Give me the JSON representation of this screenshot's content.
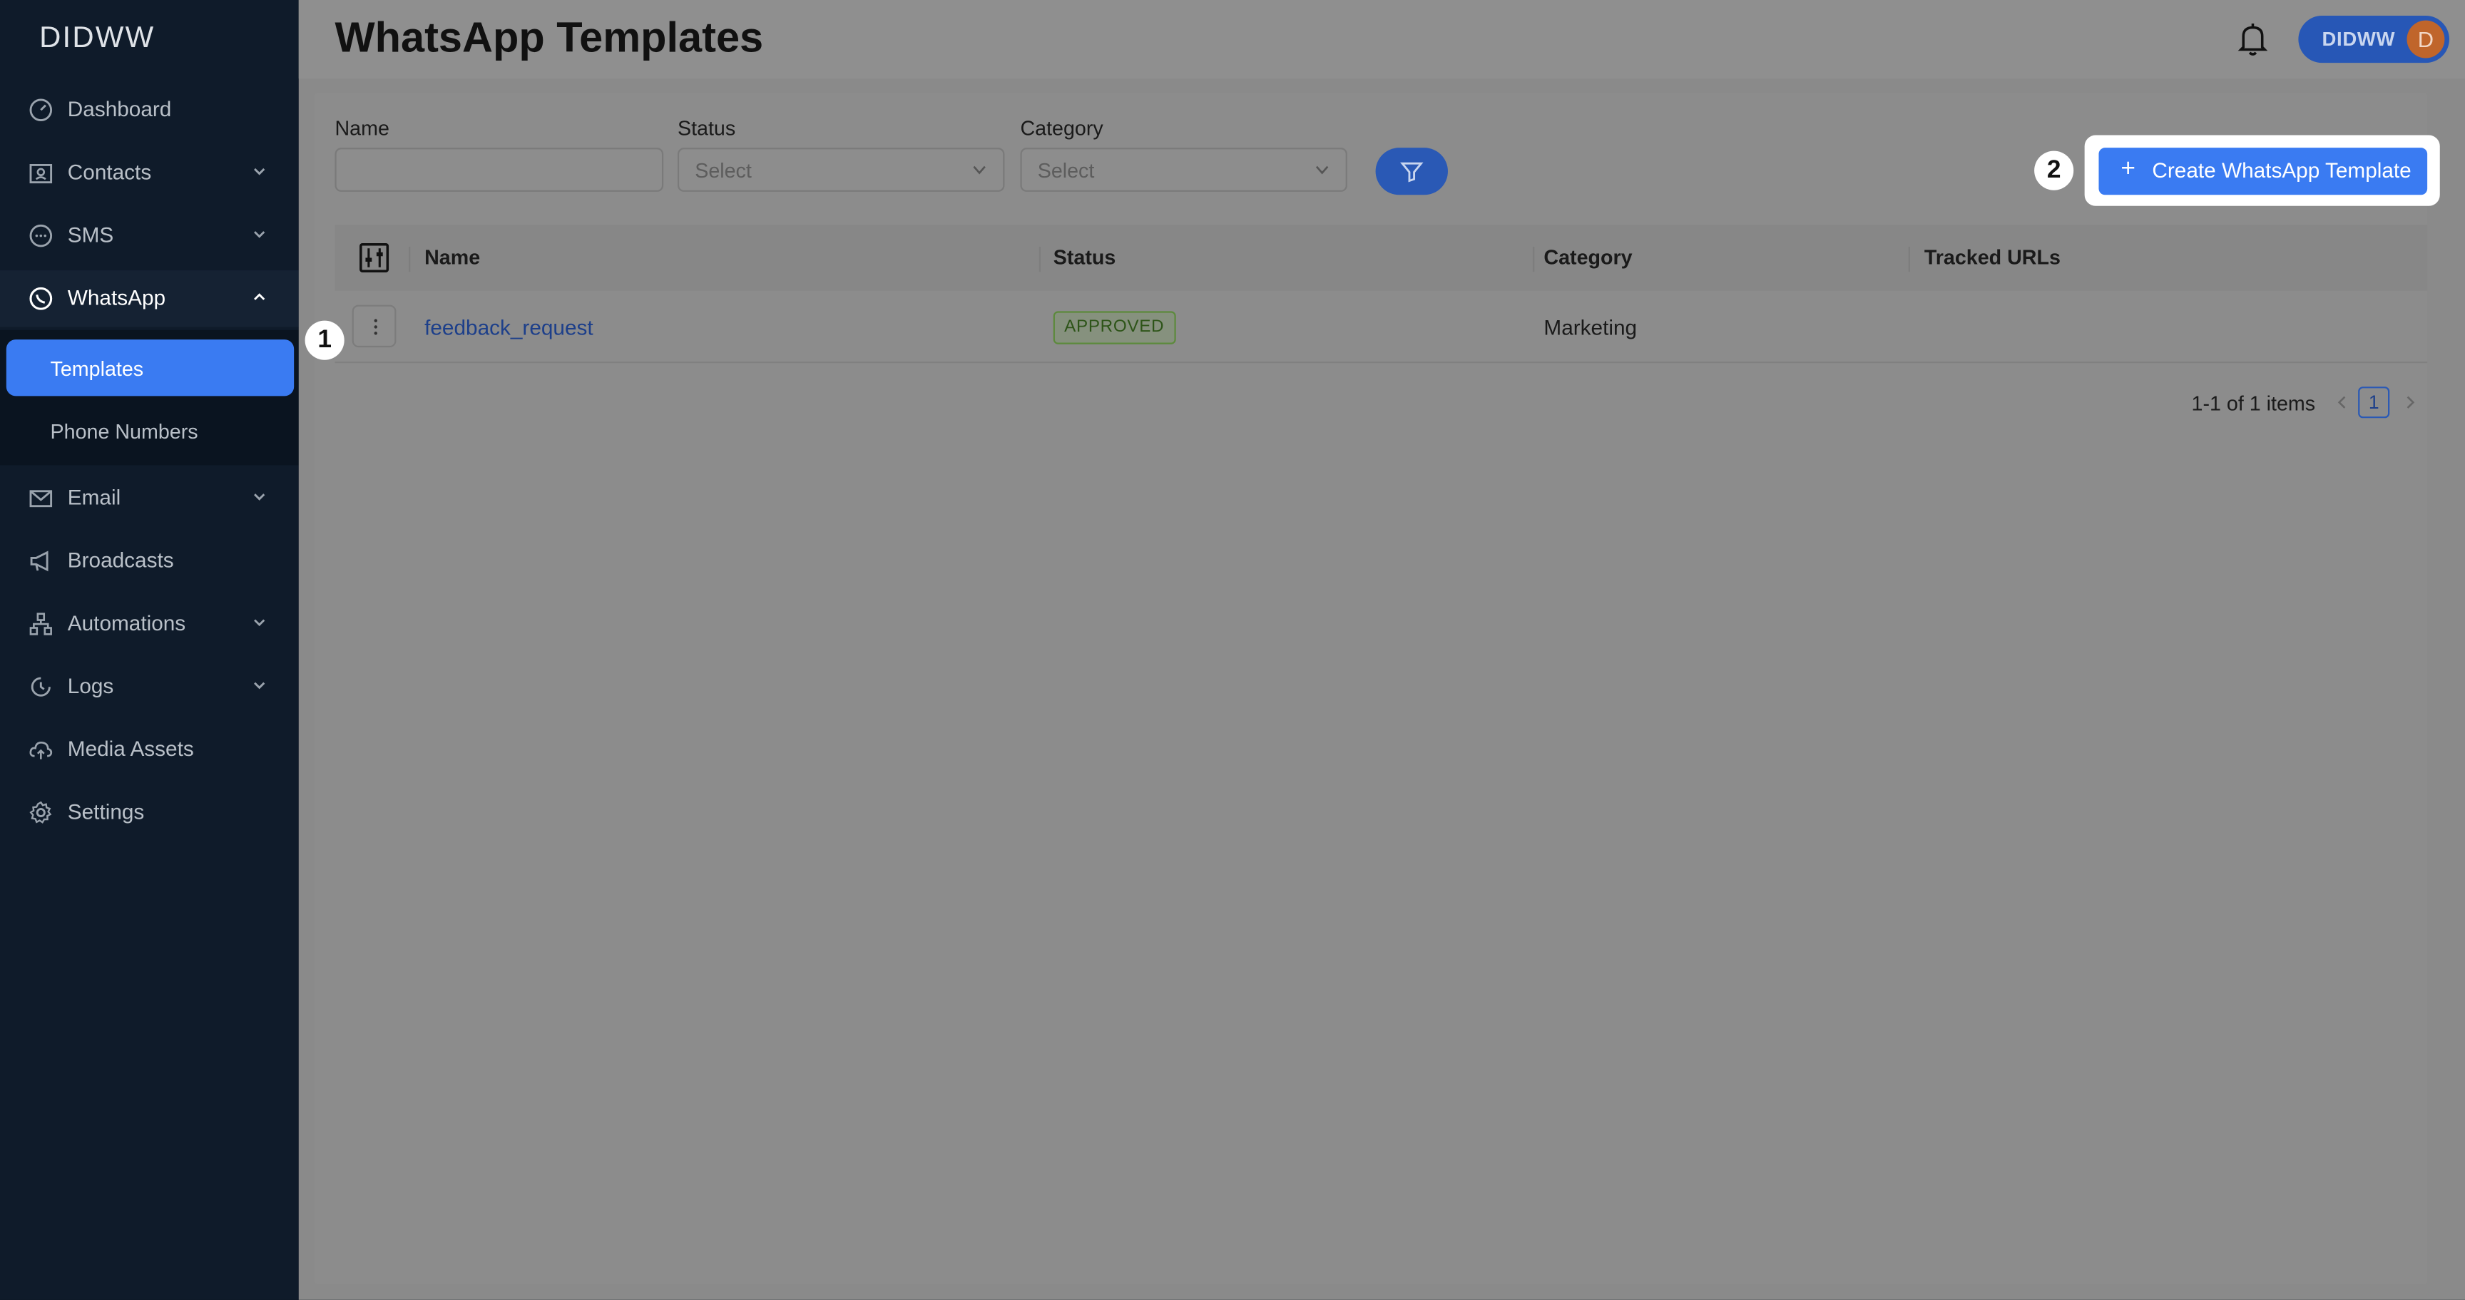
{
  "app": {
    "logo": "DIDWW"
  },
  "sidebar": {
    "items": [
      {
        "label": "Dashboard",
        "icon": "dashboard-icon"
      },
      {
        "label": "Contacts",
        "icon": "contacts-icon"
      },
      {
        "label": "SMS",
        "icon": "sms-icon"
      },
      {
        "label": "WhatsApp",
        "icon": "whatsapp-icon"
      },
      {
        "label": "Email",
        "icon": "email-icon"
      },
      {
        "label": "Broadcasts",
        "icon": "megaphone-icon"
      },
      {
        "label": "Automations",
        "icon": "automations-icon"
      },
      {
        "label": "Logs",
        "icon": "logs-icon"
      },
      {
        "label": "Media Assets",
        "icon": "cloud-upload-icon"
      },
      {
        "label": "Settings",
        "icon": "gear-icon"
      }
    ],
    "whatsapp_sub": [
      {
        "label": "Templates"
      },
      {
        "label": "Phone Numbers"
      }
    ]
  },
  "header": {
    "title": "WhatsApp Templates",
    "user_name": "DIDWW",
    "avatar_letter": "D"
  },
  "filters": {
    "name_label": "Name",
    "status_label": "Status",
    "status_placeholder": "Select",
    "category_label": "Category",
    "category_placeholder": "Select"
  },
  "create_button": "Create WhatsApp Template",
  "table": {
    "columns": [
      "Name",
      "Status",
      "Category",
      "Tracked URLs"
    ],
    "rows": [
      {
        "name": "feedback_request",
        "status": "APPROVED",
        "category": "Marketing",
        "tracked_urls": ""
      }
    ]
  },
  "pagination": {
    "summary": "1-1 of 1 items",
    "current_page": "1"
  },
  "markers": [
    "1",
    "2"
  ],
  "colors": {
    "accent": "#3a7bf2",
    "sidebar": "#0f1b2a",
    "approved": "#5c8a3c"
  }
}
